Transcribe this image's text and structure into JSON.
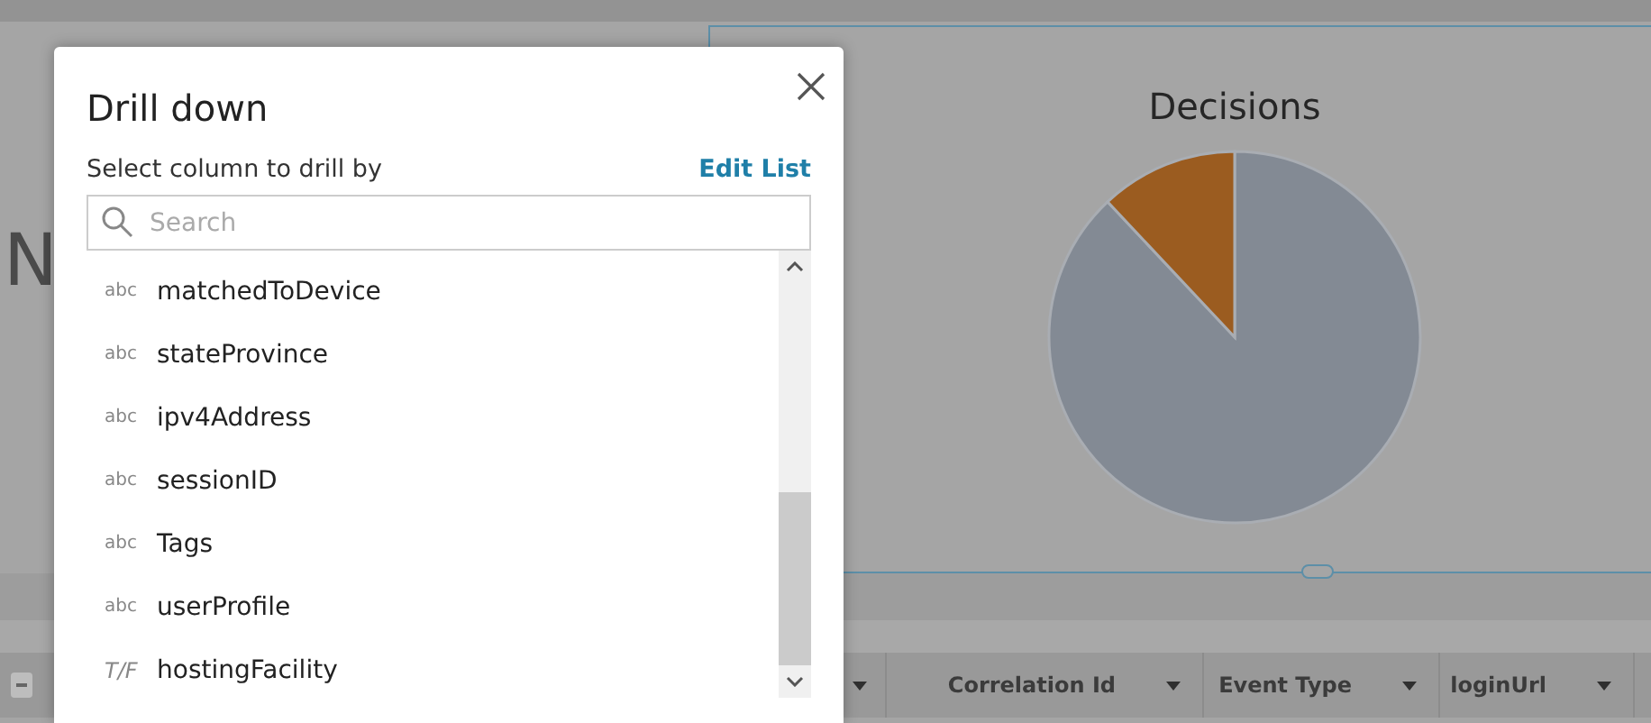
{
  "background": {
    "heading_fragment": "N",
    "chart": {
      "title": "Decisions"
    },
    "table_columns": [
      {
        "label": "Correlation Id"
      },
      {
        "label": "Event Type"
      },
      {
        "label": "loginUrl"
      }
    ]
  },
  "dialog": {
    "title": "Drill down",
    "subtitle": "Select column to drill by",
    "edit_link": "Edit List",
    "search": {
      "placeholder": "Search"
    },
    "items": [
      {
        "kind": "text",
        "type_label": "abc",
        "label": "matchedToDevice"
      },
      {
        "kind": "text",
        "type_label": "abc",
        "label": "stateProvince"
      },
      {
        "kind": "text",
        "type_label": "abc",
        "label": "ipv4Address"
      },
      {
        "kind": "text",
        "type_label": "abc",
        "label": "sessionID"
      },
      {
        "kind": "text",
        "type_label": "abc",
        "label": "Tags"
      },
      {
        "kind": "text",
        "type_label": "abc",
        "label": "userProfile"
      },
      {
        "kind": "boolean",
        "type_label": "T/F",
        "label": "hostingFacility"
      }
    ]
  }
}
